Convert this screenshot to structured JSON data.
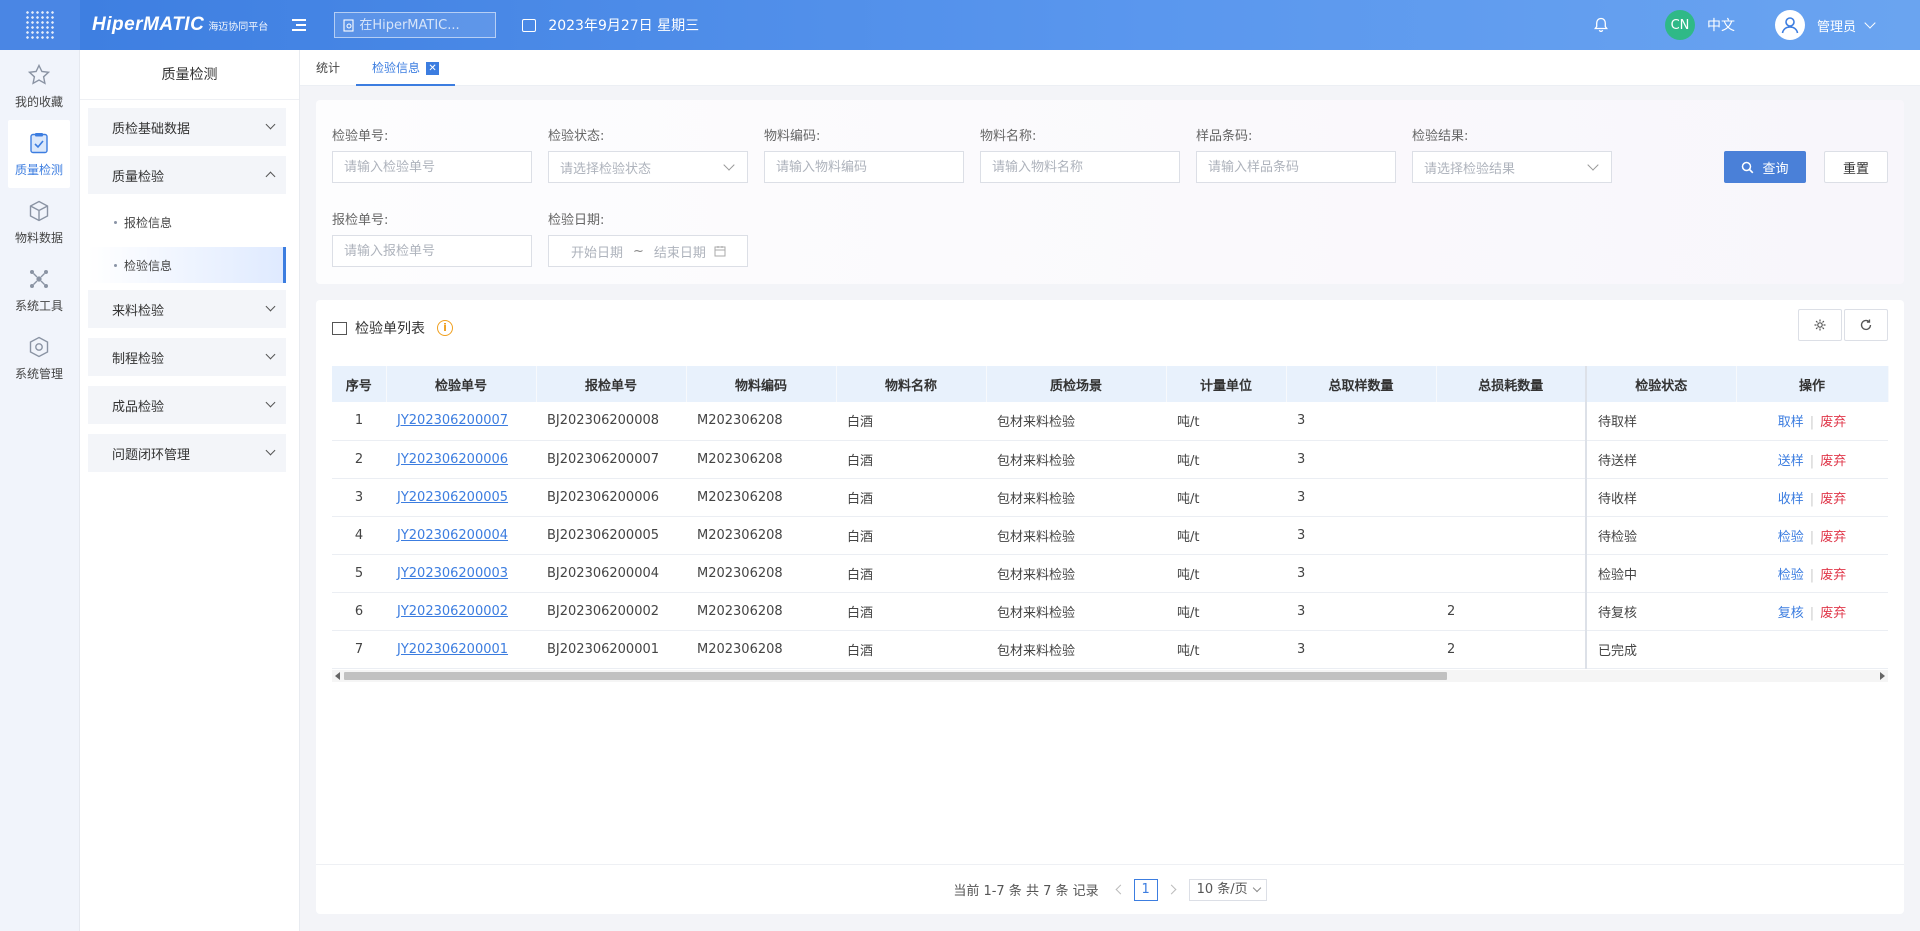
{
  "header": {
    "logo_main": "HiperMATIC",
    "logo_sub": "海迈协同平台",
    "search_placeholder": "在HiperMATIC...",
    "date": "2023年9月27日 星期三",
    "lang_badge": "CN",
    "lang_label": "中文",
    "user_name": "管理员"
  },
  "rail": {
    "items": [
      {
        "label": "我的收藏",
        "icon": "star-icon"
      },
      {
        "label": "质量检测",
        "icon": "clipboard-check-icon"
      },
      {
        "label": "物料数据",
        "icon": "cube-icon"
      },
      {
        "label": "系统工具",
        "icon": "network-icon"
      },
      {
        "label": "系统管理",
        "icon": "settings-cube-icon"
      }
    ]
  },
  "sidebar": {
    "title": "质量检测",
    "groups": [
      {
        "label": "质检基础数据"
      },
      {
        "label": "质量检验"
      },
      {
        "label": "来料检验"
      },
      {
        "label": "制程检验"
      },
      {
        "label": "成品检验"
      },
      {
        "label": "问题闭环管理"
      }
    ],
    "subs": [
      {
        "label": "报检信息"
      },
      {
        "label": "检验信息"
      }
    ]
  },
  "tabs": [
    {
      "label": "统计"
    },
    {
      "label": "检验信息",
      "close": "✕"
    }
  ],
  "filter": {
    "inspect_no": {
      "label": "检验单号:",
      "placeholder": "请输入检验单号"
    },
    "inspect_status": {
      "label": "检验状态:",
      "placeholder": "请选择检验状态"
    },
    "material_code": {
      "label": "物料编码:",
      "placeholder": "请输入物料编码"
    },
    "material_name": {
      "label": "物料名称:",
      "placeholder": "请输入物料名称"
    },
    "sample_barcode": {
      "label": "样品条码:",
      "placeholder": "请输入样品条码"
    },
    "inspect_result": {
      "label": "检验结果:",
      "placeholder": "请选择检验结果"
    },
    "report_no": {
      "label": "报检单号:",
      "placeholder": "请输入报检单号"
    },
    "inspect_date": {
      "label": "检验日期:",
      "start": "开始日期",
      "tilde": "~",
      "end": "结束日期"
    },
    "query_label": "查询",
    "reset_label": "重置"
  },
  "list": {
    "title": "检验单列表",
    "warn_mark": "i",
    "columns": [
      "序号",
      "检验单号",
      "报检单号",
      "物料编码",
      "物料名称",
      "质检场景",
      "计量单位",
      "总取样数量",
      "总损耗数量",
      "检验状态",
      "操作"
    ],
    "rows": [
      {
        "idx": "1",
        "inspect_no": "JY202306200007",
        "report_no": "BJ202306200008",
        "material_code": "M202306208",
        "material_name": "白酒",
        "scene": "包材来料检验",
        "unit": "吨/t",
        "sample_qty": "3",
        "loss_qty": "",
        "status": "待取样",
        "op1": "取样",
        "op2": "废弃"
      },
      {
        "idx": "2",
        "inspect_no": "JY202306200006",
        "report_no": "BJ202306200007",
        "material_code": "M202306208",
        "material_name": "白酒",
        "scene": "包材来料检验",
        "unit": "吨/t",
        "sample_qty": "3",
        "loss_qty": "",
        "status": "待送样",
        "op1": "送样",
        "op2": "废弃"
      },
      {
        "idx": "3",
        "inspect_no": "JY202306200005",
        "report_no": "BJ202306200006",
        "material_code": "M202306208",
        "material_name": "白酒",
        "scene": "包材来料检验",
        "unit": "吨/t",
        "sample_qty": "3",
        "loss_qty": "",
        "status": "待收样",
        "op1": "收样",
        "op2": "废弃"
      },
      {
        "idx": "4",
        "inspect_no": "JY202306200004",
        "report_no": "BJ202306200005",
        "material_code": "M202306208",
        "material_name": "白酒",
        "scene": "包材来料检验",
        "unit": "吨/t",
        "sample_qty": "3",
        "loss_qty": "",
        "status": "待检验",
        "op1": "检验",
        "op2": "废弃"
      },
      {
        "idx": "5",
        "inspect_no": "JY202306200003",
        "report_no": "BJ202306200004",
        "material_code": "M202306208",
        "material_name": "白酒",
        "scene": "包材来料检验",
        "unit": "吨/t",
        "sample_qty": "3",
        "loss_qty": "",
        "status": "检验中",
        "op1": "检验",
        "op2": "废弃"
      },
      {
        "idx": "6",
        "inspect_no": "JY202306200002",
        "report_no": "BJ202306200002",
        "material_code": "M202306208",
        "material_name": "白酒",
        "scene": "包材来料检验",
        "unit": "吨/t",
        "sample_qty": "3",
        "loss_qty": "2",
        "status": "待复核",
        "op1": "复核",
        "op2": "废弃"
      },
      {
        "idx": "7",
        "inspect_no": "JY202306200001",
        "report_no": "BJ202306200001",
        "material_code": "M202306208",
        "material_name": "白酒",
        "scene": "包材来料检验",
        "unit": "吨/t",
        "sample_qty": "3",
        "loss_qty": "2",
        "status": "已完成",
        "op1": "",
        "op2": ""
      }
    ]
  },
  "pager": {
    "summary": "当前 1-7 条 共 7 条 记录",
    "current_page": "1",
    "page_size": "10 条/页"
  },
  "colors": {
    "accent": "#3c7de0",
    "danger": "#e0384b",
    "header_bg": "#e8f1fc"
  }
}
